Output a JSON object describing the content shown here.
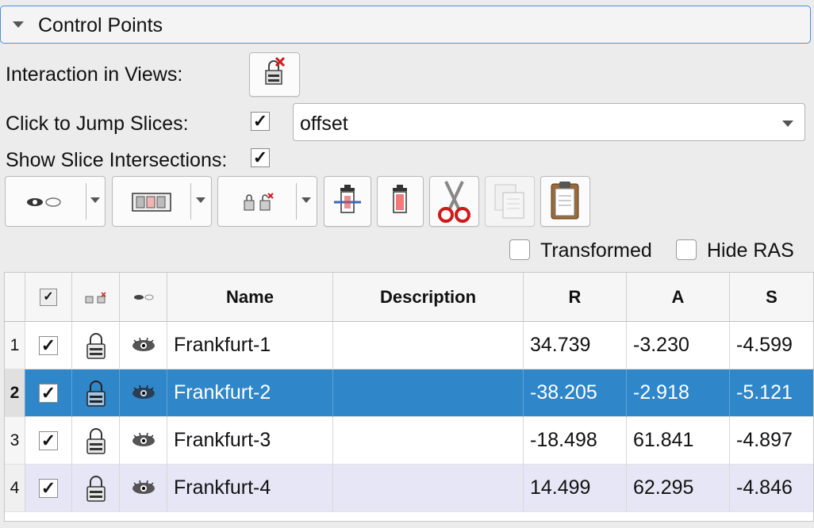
{
  "panel": {
    "title": "Control Points"
  },
  "controls": {
    "interaction_label": "Interaction in Views:",
    "jump_label": "Click to Jump Slices:",
    "jump_checked": "✓",
    "jump_mode": "offset",
    "intersections_label": "Show Slice Intersections:",
    "intersections_checked": "✓"
  },
  "options": {
    "transformed": "Transformed",
    "hide_ras": "Hide RAS"
  },
  "table": {
    "columns": [
      "",
      "",
      "",
      "Name",
      "Description",
      "R",
      "A",
      "S"
    ],
    "header_check": "✓",
    "rows": [
      {
        "num": "1",
        "check": "✓",
        "name": "Frankfurt-1",
        "description": "",
        "r": "34.739",
        "a": "-3.230",
        "s": "-4.599"
      },
      {
        "num": "2",
        "check": "✓",
        "name": "Frankfurt-2",
        "description": "",
        "r": "-38.205",
        "a": "-2.918",
        "s": "-5.121"
      },
      {
        "num": "3",
        "check": "✓",
        "name": "Frankfurt-3",
        "description": "",
        "r": "-18.498",
        "a": "61.841",
        "s": "-4.897"
      },
      {
        "num": "4",
        "check": "✓",
        "name": "Frankfurt-4",
        "description": "",
        "r": "14.499",
        "a": "62.295",
        "s": "-4.846"
      }
    ],
    "selected_row": "2"
  },
  "colors": {
    "accent": "#2f86c8",
    "focus_border": "#4a90d9",
    "alt_row": "#e6e6f6"
  }
}
